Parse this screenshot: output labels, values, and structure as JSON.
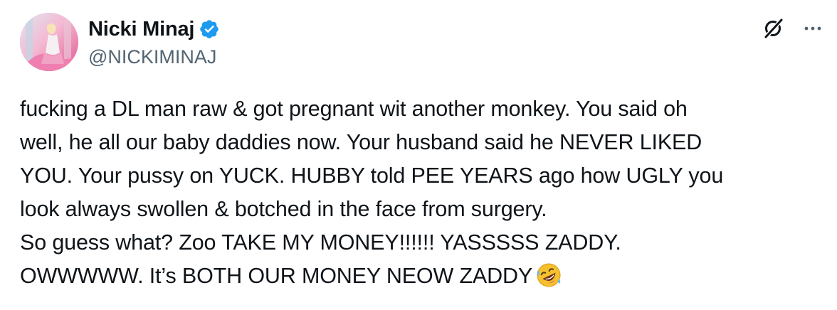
{
  "author": {
    "display_name": "Nicki Minaj",
    "handle": "@NICKIMINAJ",
    "verified": true,
    "verified_color": "#1d9bf0"
  },
  "actions": {
    "grok_icon": "grok-icon",
    "more_icon": "more-options-icon"
  },
  "tweet": {
    "lines": [
      "fucking a DL man raw & got pregnant wit another monkey. You said oh",
      "well, he all our baby daddies now. Your husband said he NEVER LIKED",
      "YOU. Your pussy on YUCK. HUBBY told PEE YEARS ago how UGLY you",
      "look always swollen & botched in the face from surgery.",
      "So guess what? Zoo TAKE MY MONEY!!!!!! YASSSSS ZADDY.",
      "OWWWWW. It’s BOTH OUR MONEY NEOW ZADDY"
    ],
    "trailing_emoji": "rolling-on-the-floor-laughing-emoji"
  }
}
